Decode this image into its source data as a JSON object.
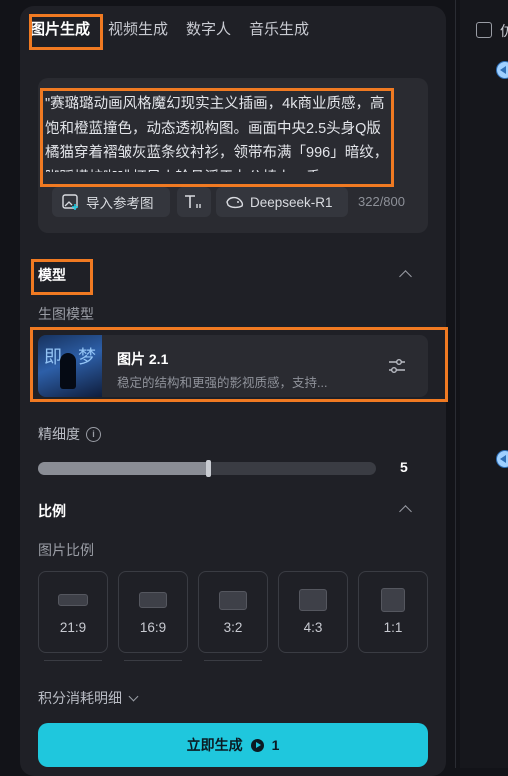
{
  "tabs": [
    {
      "label": "图片生成",
      "active": true
    },
    {
      "label": "视频生成",
      "active": false
    },
    {
      "label": "数字人",
      "active": false
    },
    {
      "label": "音乐生成",
      "active": false
    }
  ],
  "prompt": {
    "text": "\"赛璐璐动画风格魔幻现实主义插画，4k商业质感，高饱和橙蓝撞色，动态透视构图。画面中央2.5头身Q版橘猫穿着褶皱灰蓝条纹衬衫，领带布满「996」暗纹，脚踩蟒蛇咖啡杯风火轮悬浮于办公椅上，手",
    "import_label": "导入参考图",
    "model_chip": "Deepseek-R1",
    "counter": "322/800"
  },
  "model_section": {
    "title": "模型",
    "sub_label": "生图模型",
    "model_name": "图片 2.1",
    "model_desc": "稳定的结构和更强的影视质感，支持..."
  },
  "precision": {
    "label": "精细度",
    "value": "5",
    "fraction": 0.5
  },
  "ratio_section": {
    "title": "比例",
    "sub_label": "图片比例",
    "options": [
      "21:9",
      "16:9",
      "3:2",
      "4:3",
      "1:1"
    ]
  },
  "cost_label": "积分消耗明细",
  "generate": {
    "label": "立即生成",
    "cost": "1"
  },
  "right_panel": {
    "edge_char": "仿"
  },
  "colors": {
    "accent": "#1fc7dd",
    "highlight": "#f07a22",
    "panel": "#1f2026"
  }
}
